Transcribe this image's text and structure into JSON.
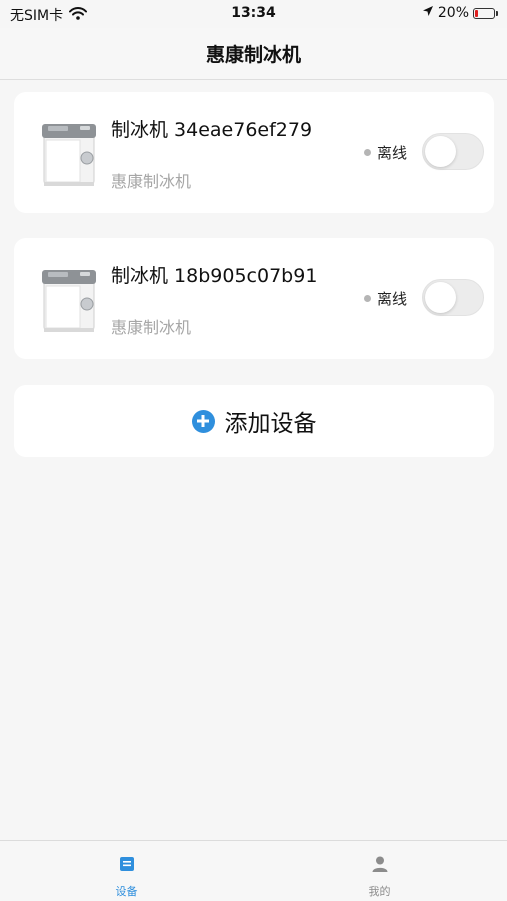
{
  "status_bar": {
    "carrier": "无SIM卡",
    "time": "13:34",
    "battery_percent": "20%",
    "battery_level": 0.2
  },
  "header": {
    "title": "惠康制冰机"
  },
  "devices": [
    {
      "name": "制冰机 34eae76ef279",
      "brand": "惠康制冰机",
      "status": "离线",
      "power_on": false
    },
    {
      "name": "制冰机 18b905c07b91",
      "brand": "惠康制冰机",
      "status": "离线",
      "power_on": false
    }
  ],
  "add_device": {
    "label": "添加设备"
  },
  "tabs": [
    {
      "label": "设备",
      "active": true,
      "icon": "device-icon"
    },
    {
      "label": "我的",
      "active": false,
      "icon": "user-icon"
    }
  ],
  "colors": {
    "accent": "#2f8fdd",
    "battery_low": "#e02020",
    "offline_dot": "#b5b5b5"
  }
}
